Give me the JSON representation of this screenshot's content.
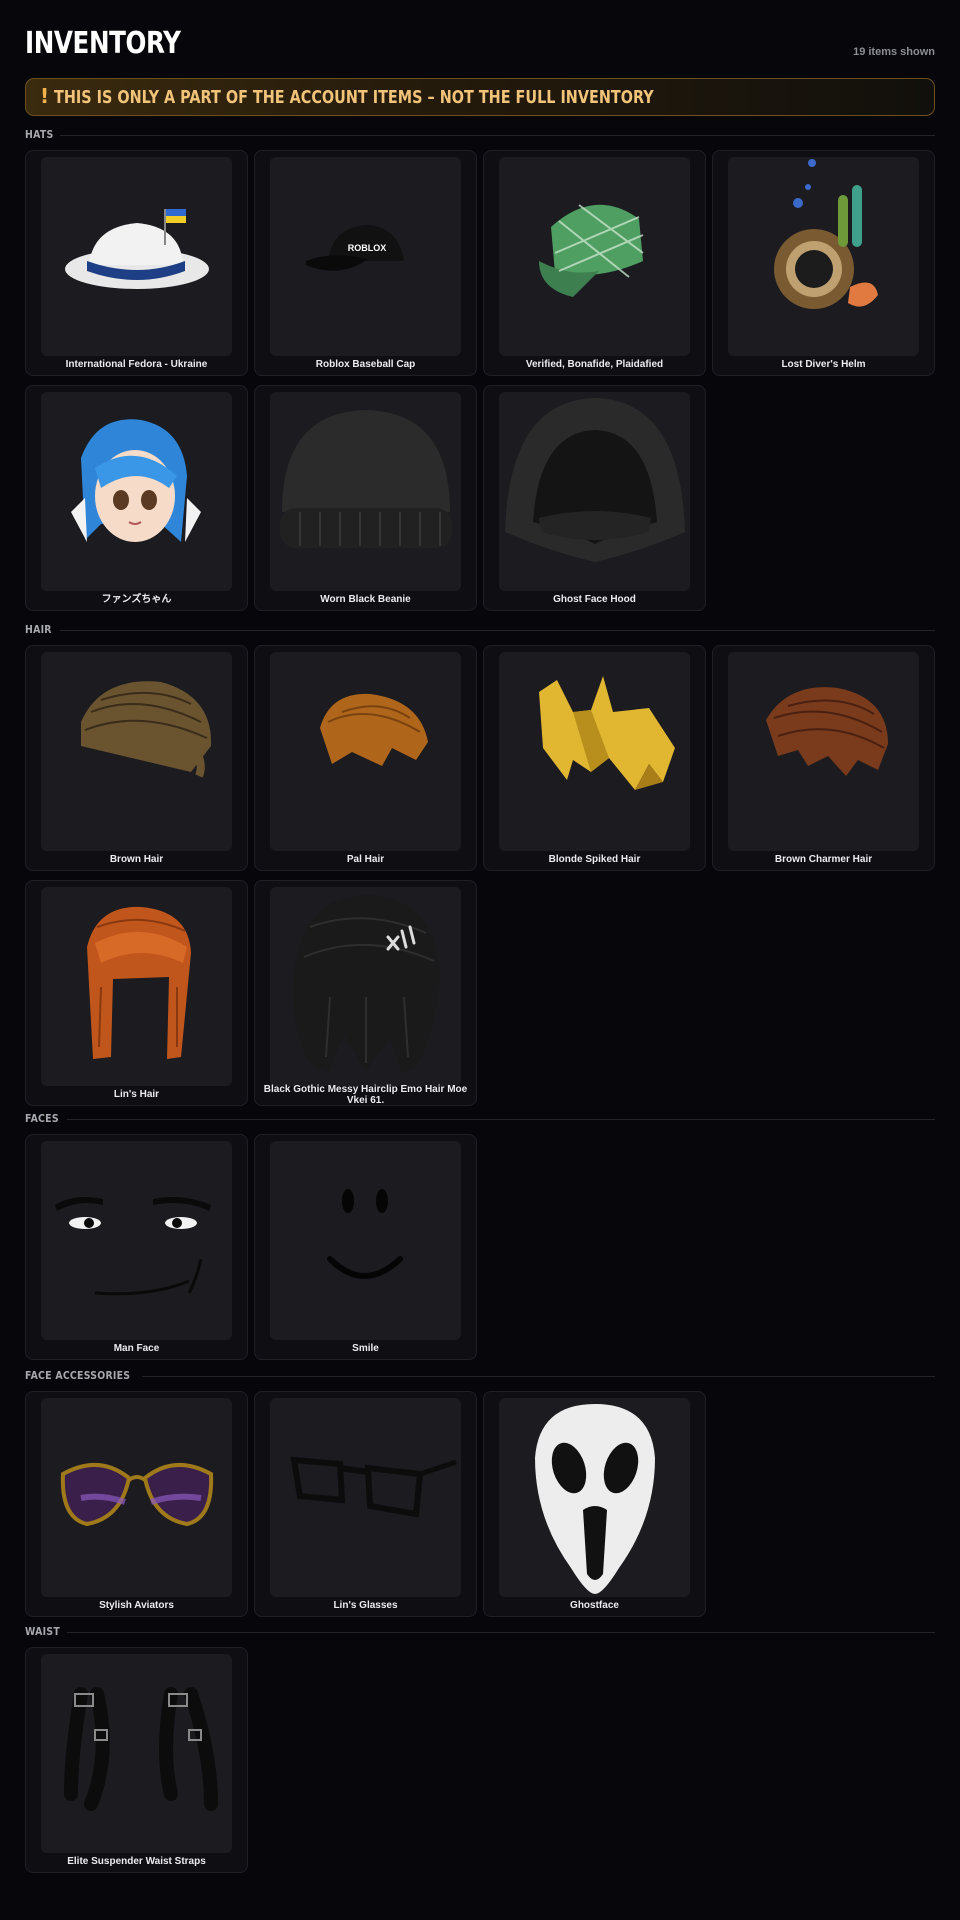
{
  "header": {
    "title": "INVENTORY",
    "count": "19 items shown"
  },
  "warning": {
    "icon": "!",
    "text": "THIS IS ONLY A PART OF THE ACCOUNT ITEMS – NOT THE FULL INVENTORY"
  },
  "sections": [
    {
      "label": "HATS",
      "items": [
        {
          "name": "International Fedora - Ukraine",
          "icon": "fedora-ukraine-icon"
        },
        {
          "name": "Roblox Baseball Cap",
          "icon": "baseball-cap-icon"
        },
        {
          "name": "Verified, Bonafide, Plaidafied",
          "icon": "plaid-cap-icon"
        },
        {
          "name": "Lost Diver's Helm",
          "icon": "diver-helm-icon"
        },
        {
          "name": "ファンズちゃん",
          "icon": "anime-head-icon"
        },
        {
          "name": "Worn Black Beanie",
          "icon": "beanie-icon"
        },
        {
          "name": "Ghost Face Hood",
          "icon": "hood-icon"
        }
      ]
    },
    {
      "label": "HAIR",
      "items": [
        {
          "name": "Brown Hair",
          "icon": "brown-hair-icon"
        },
        {
          "name": "Pal Hair",
          "icon": "pal-hair-icon"
        },
        {
          "name": "Blonde Spiked Hair",
          "icon": "spiked-hair-icon"
        },
        {
          "name": "Brown Charmer Hair",
          "icon": "charmer-hair-icon"
        },
        {
          "name": "Lin's Hair",
          "icon": "lins-hair-icon"
        },
        {
          "name": "Black Gothic Messy Hairclip Emo Hair Moe Vkei 61.",
          "icon": "emo-hair-icon"
        }
      ]
    },
    {
      "label": "FACES",
      "items": [
        {
          "name": "Man Face",
          "icon": "man-face-icon"
        },
        {
          "name": "Smile",
          "icon": "smile-face-icon"
        }
      ]
    },
    {
      "label": "FACE ACCESSORIES",
      "items": [
        {
          "name": "Stylish Aviators",
          "icon": "aviators-icon"
        },
        {
          "name": "Lin's Glasses",
          "icon": "glasses-icon"
        },
        {
          "name": "Ghostface",
          "icon": "ghostface-mask-icon"
        }
      ]
    },
    {
      "label": "WAIST",
      "items": [
        {
          "name": "Elite Suspender Waist Straps",
          "icon": "waist-straps-icon"
        }
      ]
    }
  ]
}
